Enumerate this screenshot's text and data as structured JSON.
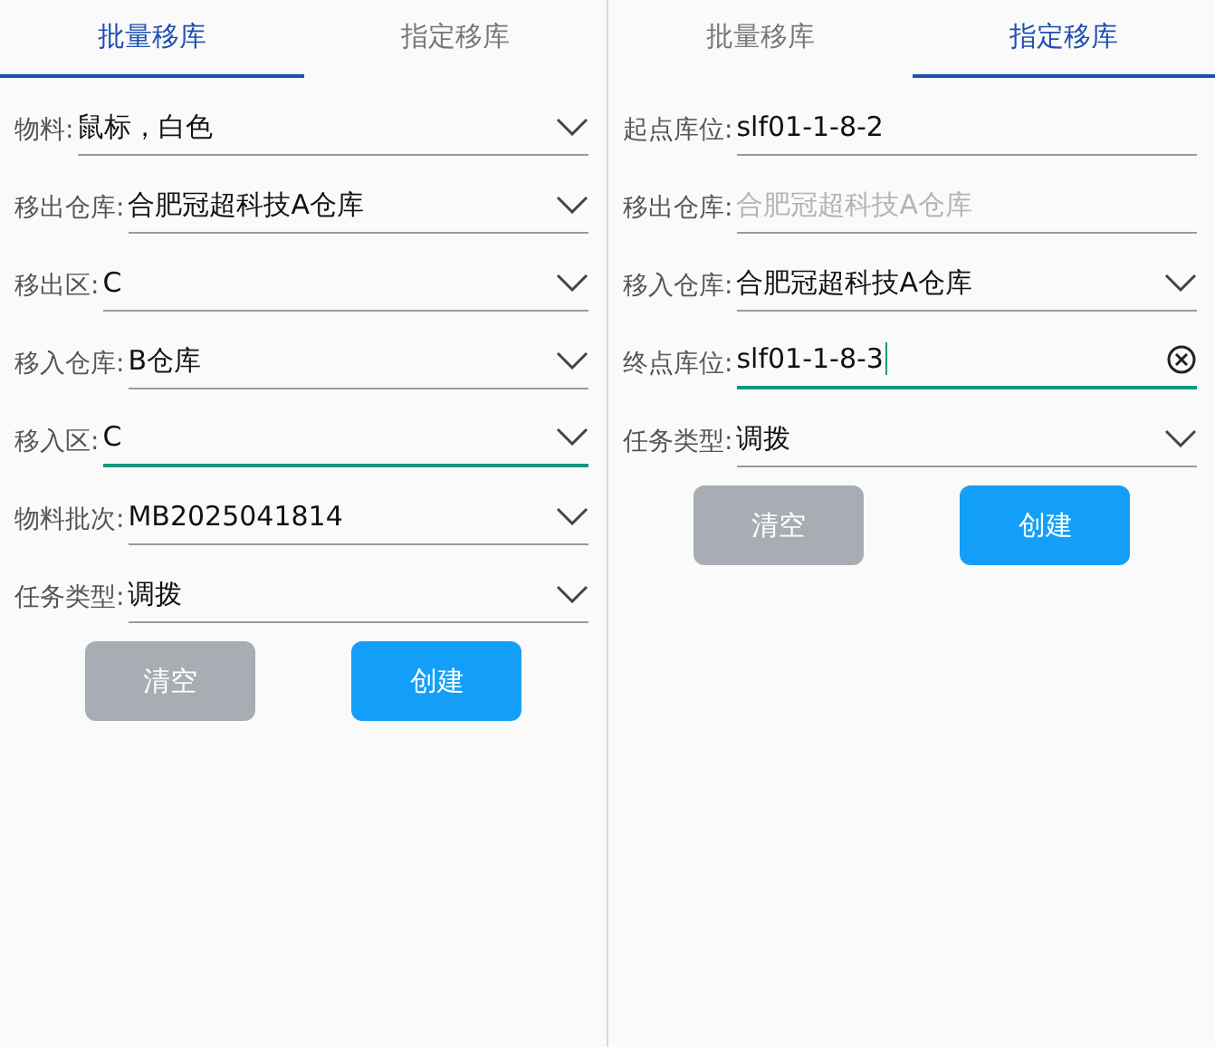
{
  "panels": [
    {
      "tabs": [
        {
          "label": "批量移库",
          "selected": true
        },
        {
          "label": "指定移库",
          "selected": false
        }
      ],
      "fields": [
        {
          "kind": "select",
          "label": "物料:",
          "value": "鼠标，白色",
          "focused": false
        },
        {
          "kind": "select",
          "label": "移出仓库:",
          "value": "合肥冠超科技A仓库",
          "focused": false
        },
        {
          "kind": "select",
          "label": "移出区:",
          "value": "C",
          "focused": false
        },
        {
          "kind": "select",
          "label": "移入仓库:",
          "value": "B仓库",
          "focused": false
        },
        {
          "kind": "select",
          "label": "移入区:",
          "value": "C",
          "focused": true
        },
        {
          "kind": "select",
          "label": "物料批次:",
          "value": "MB2025041814",
          "focused": false
        },
        {
          "kind": "select",
          "label": "任务类型:",
          "value": "调拨",
          "focused": false
        }
      ],
      "buttons": [
        {
          "kind": "secondary",
          "label": "清空"
        },
        {
          "kind": "primary",
          "label": "创建"
        }
      ]
    },
    {
      "tabs": [
        {
          "label": "批量移库",
          "selected": false
        },
        {
          "label": "指定移库",
          "selected": true
        }
      ],
      "fields": [
        {
          "kind": "input",
          "label": "起点库位:",
          "value": "slf01-1-8-2",
          "focused": false
        },
        {
          "kind": "input",
          "label": "移出仓库:",
          "placeholder": "合肥冠超科技A仓库",
          "focused": false
        },
        {
          "kind": "select",
          "label": "移入仓库:",
          "value": "合肥冠超科技A仓库",
          "focused": false
        },
        {
          "kind": "clearable",
          "label": "终点库位:",
          "value": "slf01-1-8-3",
          "focused": true
        },
        {
          "kind": "select",
          "label": "任务类型:",
          "value": "调拨",
          "focused": false
        }
      ],
      "buttons": [
        {
          "kind": "secondary",
          "label": "清空"
        },
        {
          "kind": "primary",
          "label": "创建"
        }
      ]
    }
  ]
}
